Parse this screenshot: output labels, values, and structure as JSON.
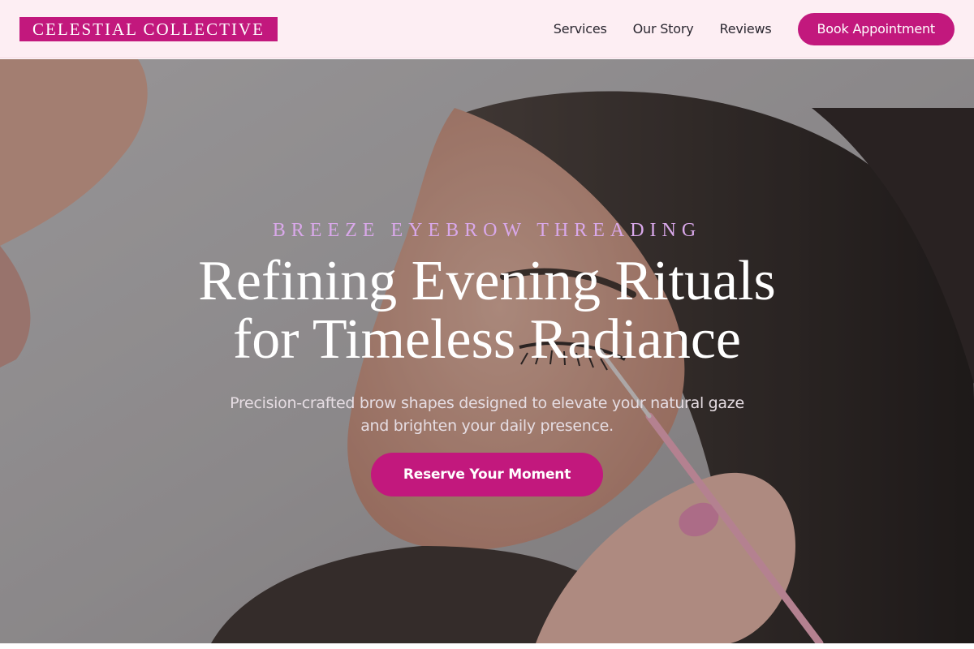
{
  "header": {
    "logo_text": "CELESTIAL COLLECTIVE",
    "nav": [
      {
        "label": "Services"
      },
      {
        "label": "Our Story"
      },
      {
        "label": "Reviews"
      }
    ],
    "book_button": "Book Appointment"
  },
  "hero": {
    "eyebrow": "BREEZE EYEBROW THREADING",
    "headline_line1": "Refining Evening Rituals",
    "headline_line2": "for Timeless Radiance",
    "subhead": "Precision-crafted brow shapes designed to elevate your natural gaze and brighten your daily presence.",
    "cta": "Reserve Your Moment",
    "image_alt": "Woman receiving eyebrow threading treatment"
  },
  "colors": {
    "brand": "#c2187d",
    "header_bg": "#fdeef3",
    "eyebrow": "#d9a8ea"
  },
  "icons": {
    "hero_photo": "portrait-photo-illustration"
  }
}
